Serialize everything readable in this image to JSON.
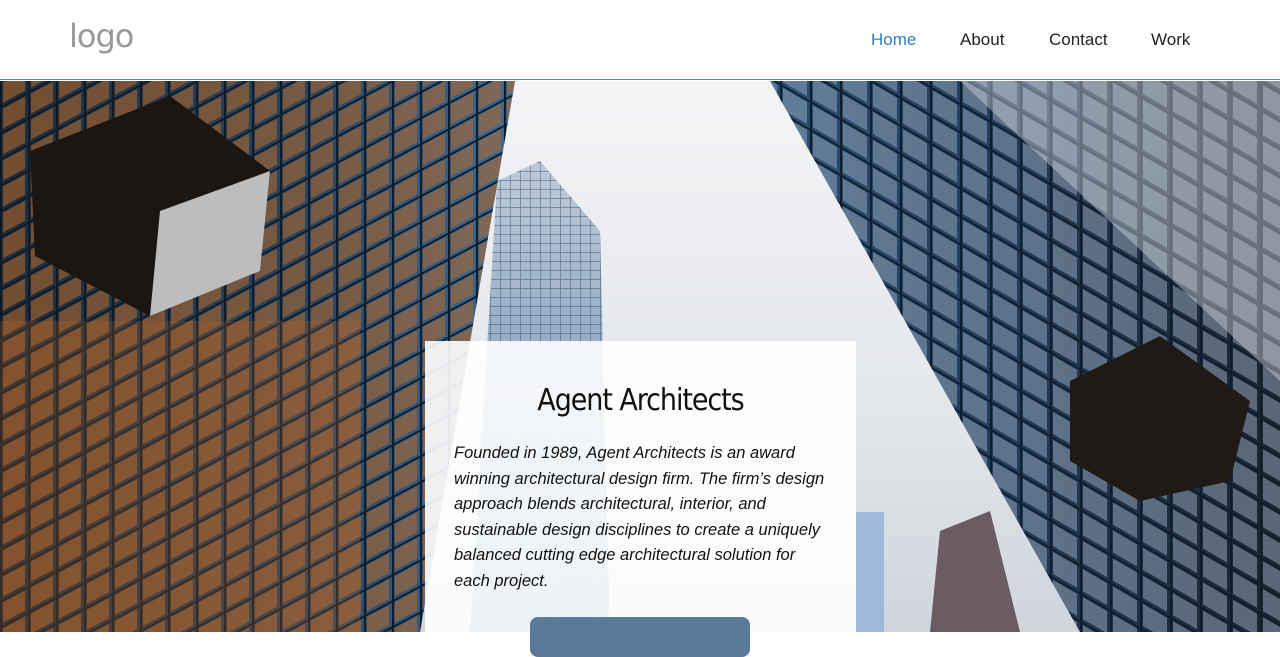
{
  "header": {
    "logo_text": "logo",
    "nav": [
      {
        "label": "Home",
        "active": true
      },
      {
        "label": "About",
        "active": false
      },
      {
        "label": "Contact",
        "active": false
      },
      {
        "label": "Work",
        "active": false
      }
    ]
  },
  "hero": {
    "image_subject": "skyscrapers-looking-up",
    "card": {
      "title": "Agent Architects",
      "body": "Founded in 1989, Agent Architects is an award winning architectural design firm. The firm’s design approach blends architectural, interior, and sustainable design disciplines to create a uniquely balanced cutting edge architectural solution for each project."
    }
  },
  "colors": {
    "accent": "#2f7fc1",
    "header_border": "#5b86b3",
    "button": "#5a7a9a"
  }
}
